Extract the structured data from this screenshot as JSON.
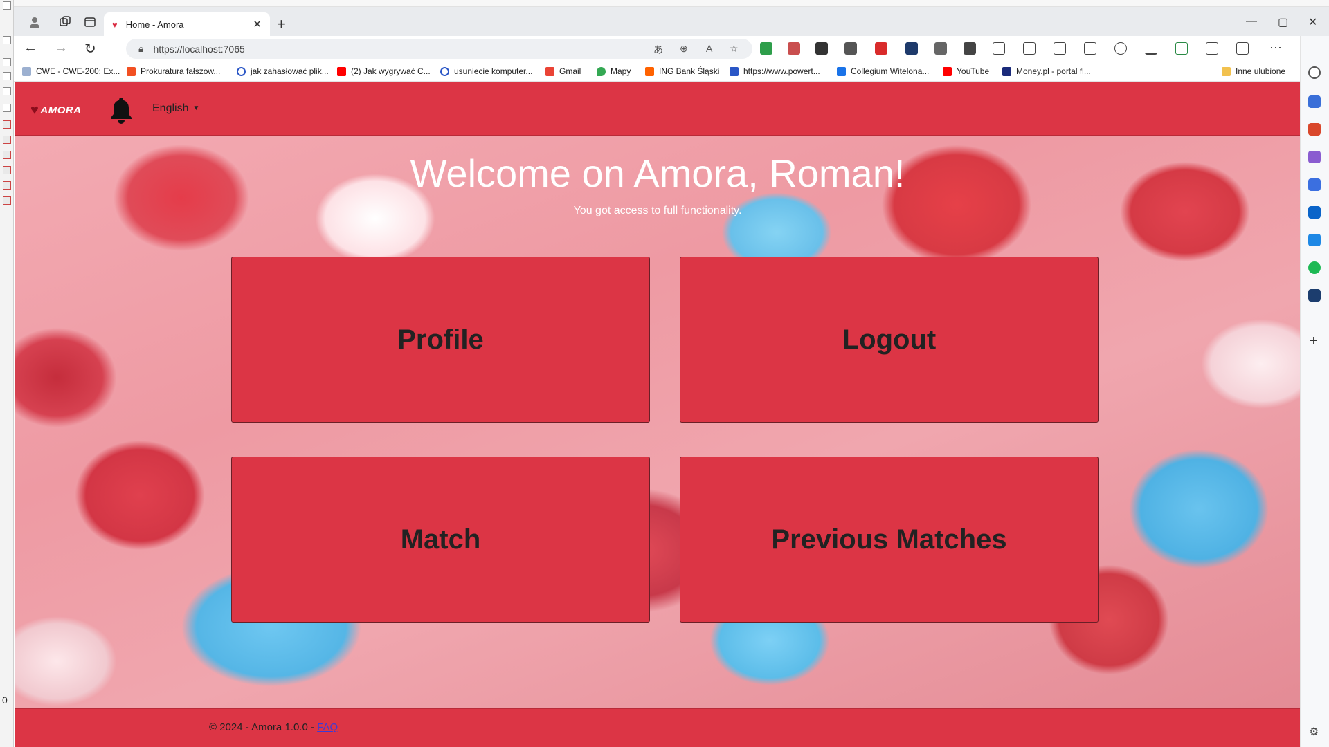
{
  "browser": {
    "tab": {
      "title": "Home - Amora"
    },
    "address": {
      "url": "https://localhost:7065"
    },
    "bookmarks": [
      "CWE - CWE-200: Ex...",
      "Prokuratura fałszow...",
      "jak zahasłować plik...",
      "(2) Jak wygrywać C...",
      "usuniecie komputer...",
      "Gmail",
      "Mapy",
      "ING Bank Śląski",
      "https://www.powert...",
      "Collegium Witelona...",
      "YouTube",
      "Money.pl - portal fi..."
    ],
    "other_favorites": "Inne ulubione"
  },
  "left_strip": {
    "value": "0"
  },
  "site": {
    "logo_text": "AMORA",
    "language": "English",
    "hero": {
      "title": "Welcome on Amora, Roman!",
      "subtitle": "You got access to full functionality."
    },
    "cards": {
      "profile": "Profile",
      "logout": "Logout",
      "match": "Match",
      "previous_matches": "Previous Matches"
    },
    "footer": {
      "copyright": "© 2024 - Amora 1.0.0 - ",
      "faq": "FAQ"
    }
  },
  "colors": {
    "brand": "#dc3545",
    "link": "#3b3bd6"
  }
}
